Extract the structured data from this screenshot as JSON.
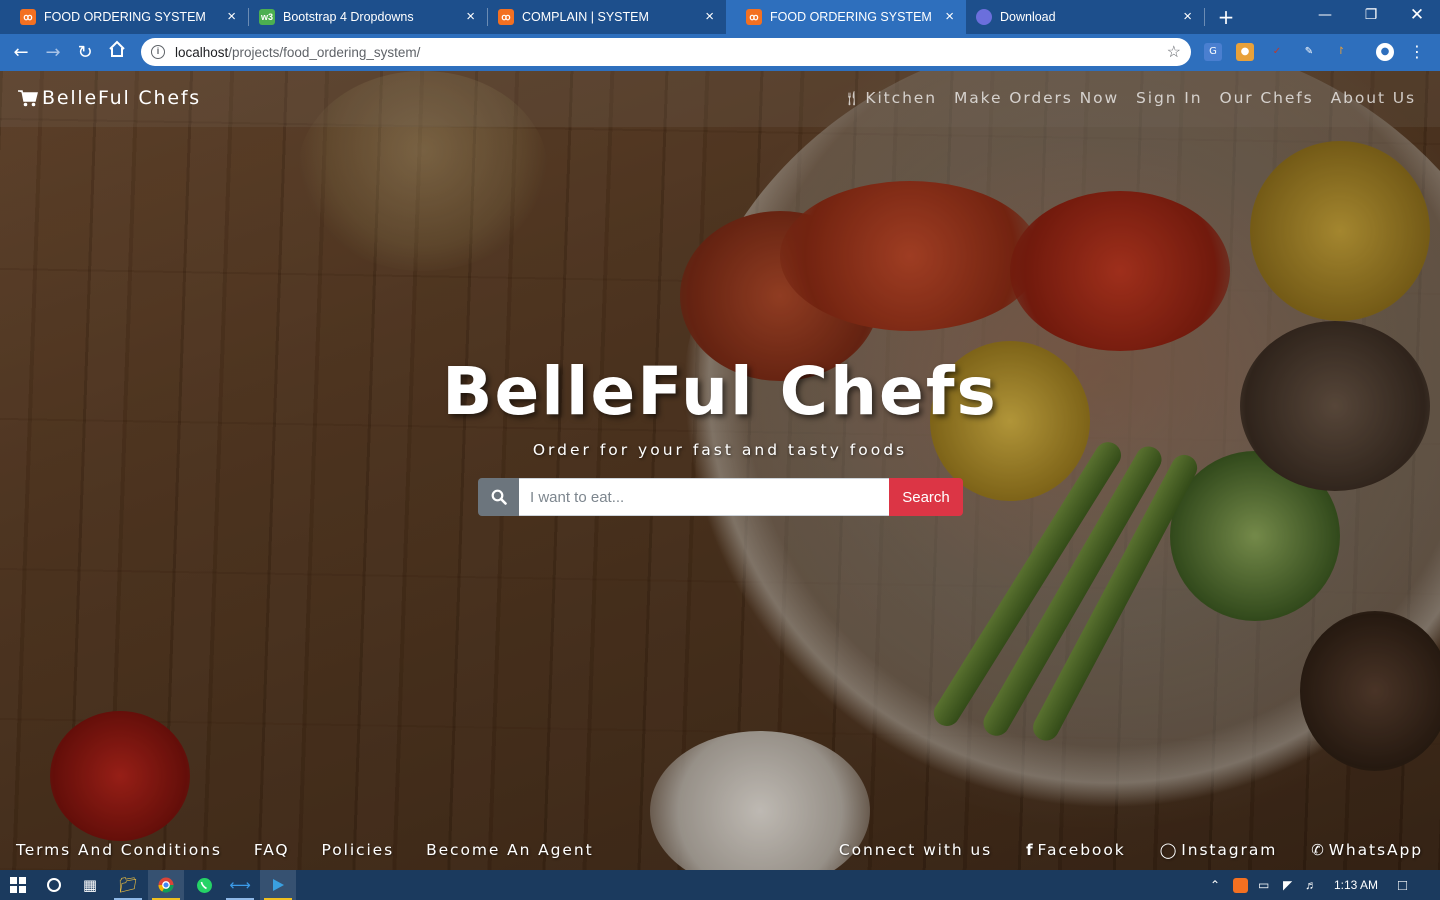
{
  "browser": {
    "tabs": [
      {
        "title": "FOOD ORDERING SYSTEM",
        "favicon": "xampp-icon",
        "active": false
      },
      {
        "title": "Bootstrap 4 Dropdowns",
        "favicon": "w3schools-icon",
        "active": false
      },
      {
        "title": "COMPLAIN | SYSTEM",
        "favicon": "xampp-icon",
        "active": false
      },
      {
        "title": "FOOD ORDERING SYSTEM",
        "favicon": "xampp-icon",
        "active": true
      },
      {
        "title": "Download",
        "favicon": "download-icon",
        "active": false
      }
    ],
    "tab_close_glyph": "×",
    "new_tab_glyph": "+",
    "address": {
      "host": "localhost",
      "path": "/projects/food_ordering_system/"
    }
  },
  "site": {
    "brand": "BelleFul Chefs",
    "nav": [
      "Kitchen",
      "Make Orders Now",
      "Sign In",
      "Our Chefs",
      "About Us"
    ],
    "hero": {
      "title": "BelleFul Chefs",
      "subtitle": "Order for your fast and tasty foods"
    },
    "search": {
      "placeholder": "I want to eat...",
      "button": "Search"
    },
    "footer_left": [
      "Terms And Conditions",
      "FAQ",
      "Policies",
      "Become An Agent"
    ],
    "footer_right": {
      "connect": "Connect with us",
      "links": [
        {
          "label": "Facebook",
          "icon": "facebook-icon"
        },
        {
          "label": "Instagram",
          "icon": "instagram-icon"
        },
        {
          "label": "WhatsApp",
          "icon": "whatsapp-icon"
        }
      ]
    }
  },
  "taskbar": {
    "clock": "1:13 AM"
  },
  "colors": {
    "chrome_frame": "#1d4f8c",
    "chrome_toolbar": "#2e6fbd",
    "search_button": "#dc3545",
    "search_icon_bg": "#6c757d",
    "taskbar": "#1b3a5e"
  }
}
